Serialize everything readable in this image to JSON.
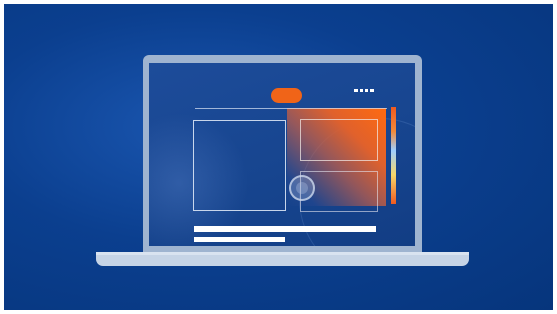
{
  "illustration": {
    "subject": "laptop",
    "colors": {
      "background": "#0b3f8f",
      "accent": "#f06418",
      "laptop_frame": "#9fb4d0",
      "laptop_base": "#c6d4e6",
      "screen": "#17458f"
    }
  }
}
